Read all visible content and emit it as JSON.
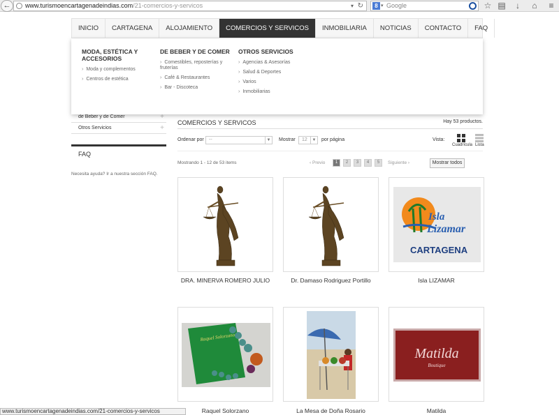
{
  "browser": {
    "url_domain": "www.turismoencartagenadeindias.com",
    "url_path": "/21-comercios-y-servicos",
    "search_placeholder": "Google",
    "status_url": "www.turismoencartagenadeindias.com/21-comercios-y-servicos"
  },
  "nav": {
    "items": [
      "INICIO",
      "CARTAGENA",
      "ALOJAMIENTO",
      "COMERCIOS Y SERVICOS",
      "INMOBILIARIA",
      "NOTICIAS",
      "CONTACTO",
      "FAQ"
    ],
    "active": "COMERCIOS Y SERVICOS"
  },
  "dropdown": {
    "col1": {
      "title": "MODA, ESTÉTICA Y ACCESORIOS",
      "links": [
        "Moda y complementos",
        "Centros de estética"
      ]
    },
    "col2": {
      "title": "DE BEBER Y DE COMER",
      "links": [
        "Comestibles, reposterías y fruterías",
        "Café & Restaurantes",
        "Bar - Discoteca"
      ]
    },
    "col3": {
      "title": "OTROS SERVICIOS",
      "links": [
        "Agencias & Asesorías",
        "Salud & Deportes",
        "Varios",
        "Inmobiliarias"
      ]
    }
  },
  "sidebar": {
    "items": [
      "de Beber y de Comer",
      "Otros Servicios"
    ],
    "faq_title": "FAQ",
    "faq_text": "Necesita ayuda? Ir a nuestra sección FAQ."
  },
  "main": {
    "title": "COMERCIOS Y SERVICOS",
    "count": "Hay 53 productos.",
    "ordenar_label": "Ordenar por",
    "ordenar_value": "--",
    "mostrar_label": "Mostrar",
    "mostrar_value": "12",
    "por_pagina": "por página",
    "vista_label": "Vista:",
    "vista_grid": "Cuadrícula",
    "vista_list": "Lista",
    "mostrando": "Mostrando 1 - 12 de 53 items",
    "prev": "Previo",
    "next": "Siguiente",
    "pages": [
      "1",
      "2",
      "3",
      "4",
      "5"
    ],
    "current_page": "1",
    "mostrar_todos": "Mostrar todos"
  },
  "products": [
    {
      "name": "DRA. MINERVA ROMERO JULIO",
      "image": "justice-statue"
    },
    {
      "name": "Dr. Damaso Rodriguez Portillo",
      "image": "justice-statue"
    },
    {
      "name": "Isla LIZAMAR",
      "image": "isla-lizamar-logo"
    },
    {
      "name": "Raquel Solorzano",
      "image": "green-card-jewelry"
    },
    {
      "name": "La Mesa de Doña Rosario",
      "image": "beach-umbrella-stand"
    },
    {
      "name": "Matilda",
      "image": "matilda-boutique-sign"
    }
  ],
  "logo_text": {
    "isla_line1": "Isla",
    "isla_line2": "Lizamar",
    "isla_line3": "CARTAGENA",
    "matilda_main": "Matilda",
    "matilda_sub": "Boutique",
    "raquel_card": "Raquel Solorzano"
  },
  "colors": {
    "nav_active_bg": "#333333",
    "isla_blue": "#2a5fb0",
    "isla_orange": "#f28a1c",
    "matilda_red": "#8a1f1f",
    "raquel_green": "#1f8a3a"
  }
}
